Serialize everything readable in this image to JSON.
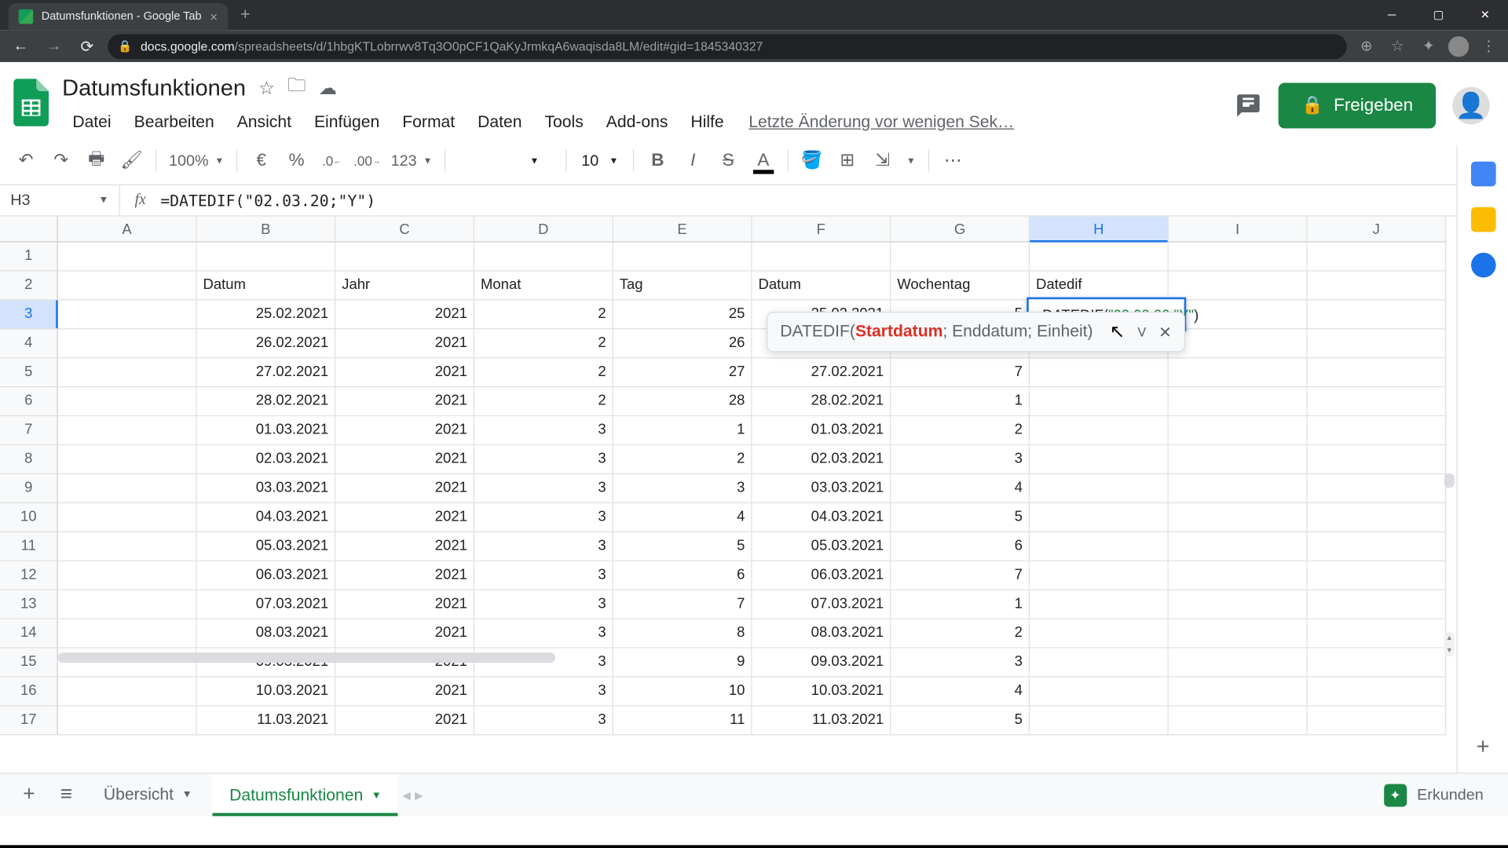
{
  "browser": {
    "tab_title": "Datumsfunktionen - Google Tab",
    "url_domain": "docs.google.com",
    "url_path": "/spreadsheets/d/1hbgKTLobrrwv8Tq3O0pCF1QaKyJrmkqA6waqisda8LM/edit#gid=1845340327"
  },
  "doc": {
    "title": "Datumsfunktionen",
    "last_edit": "Letzte Änderung vor wenigen Sek…"
  },
  "menu": {
    "file": "Datei",
    "edit": "Bearbeiten",
    "view": "Ansicht",
    "insert": "Einfügen",
    "format": "Format",
    "data": "Daten",
    "tools": "Tools",
    "addons": "Add-ons",
    "help": "Hilfe"
  },
  "toolbar": {
    "zoom": "100%",
    "currency": "€",
    "percent": "%",
    "dec_dec": ".0",
    "inc_dec": ".00",
    "format_num": "123",
    "font_size": "10"
  },
  "share": {
    "label": "Freigeben"
  },
  "name_box": "H3",
  "formula_bar": "=DATEDIF(\"02.03.20;\"Y\")",
  "columns": [
    "A",
    "B",
    "C",
    "D",
    "E",
    "F",
    "G",
    "H",
    "I",
    "J"
  ],
  "headers": {
    "B": "Datum",
    "C": "Jahr",
    "D": "Monat",
    "E": "Tag",
    "F": "Datum",
    "G": "Wochentag",
    "H": "Datedif"
  },
  "rows": [
    {
      "n": 1
    },
    {
      "n": 2
    },
    {
      "n": 3,
      "B": "25.02.2021",
      "C": "2021",
      "D": "2",
      "E": "25",
      "F": "25.02.2021",
      "G": "5"
    },
    {
      "n": 4,
      "B": "26.02.2021",
      "C": "2021",
      "D": "2",
      "E": "26",
      "F": "",
      "G": ""
    },
    {
      "n": 5,
      "B": "27.02.2021",
      "C": "2021",
      "D": "2",
      "E": "27",
      "F": "27.02.2021",
      "G": "7"
    },
    {
      "n": 6,
      "B": "28.02.2021",
      "C": "2021",
      "D": "2",
      "E": "28",
      "F": "28.02.2021",
      "G": "1"
    },
    {
      "n": 7,
      "B": "01.03.2021",
      "C": "2021",
      "D": "3",
      "E": "1",
      "F": "01.03.2021",
      "G": "2"
    },
    {
      "n": 8,
      "B": "02.03.2021",
      "C": "2021",
      "D": "3",
      "E": "2",
      "F": "02.03.2021",
      "G": "3"
    },
    {
      "n": 9,
      "B": "03.03.2021",
      "C": "2021",
      "D": "3",
      "E": "3",
      "F": "03.03.2021",
      "G": "4"
    },
    {
      "n": 10,
      "B": "04.03.2021",
      "C": "2021",
      "D": "3",
      "E": "4",
      "F": "04.03.2021",
      "G": "5"
    },
    {
      "n": 11,
      "B": "05.03.2021",
      "C": "2021",
      "D": "3",
      "E": "5",
      "F": "05.03.2021",
      "G": "6"
    },
    {
      "n": 12,
      "B": "06.03.2021",
      "C": "2021",
      "D": "3",
      "E": "6",
      "F": "06.03.2021",
      "G": "7"
    },
    {
      "n": 13,
      "B": "07.03.2021",
      "C": "2021",
      "D": "3",
      "E": "7",
      "F": "07.03.2021",
      "G": "1"
    },
    {
      "n": 14,
      "B": "08.03.2021",
      "C": "2021",
      "D": "3",
      "E": "8",
      "F": "08.03.2021",
      "G": "2"
    },
    {
      "n": 15,
      "B": "09.03.2021",
      "C": "2021",
      "D": "3",
      "E": "9",
      "F": "09.03.2021",
      "G": "3"
    },
    {
      "n": 16,
      "B": "10.03.2021",
      "C": "2021",
      "D": "3",
      "E": "10",
      "F": "10.03.2021",
      "G": "4"
    },
    {
      "n": 17,
      "B": "11.03.2021",
      "C": "2021",
      "D": "3",
      "E": "11",
      "F": "11.03.2021",
      "G": "5"
    }
  ],
  "cell_editor": {
    "prefix": "=DATEDIF(",
    "arg1": "\"02.03.20",
    "sep": ";",
    "arg2": "\"Y\"",
    "suffix": ")"
  },
  "tooltip": {
    "fn": "DATEDIF(",
    "p1": "Startdatum",
    "rest": "; Enddatum; Einheit)"
  },
  "sheets": {
    "tab1": "Übersicht",
    "tab2": "Datumsfunktionen"
  },
  "explore": "Erkunden"
}
